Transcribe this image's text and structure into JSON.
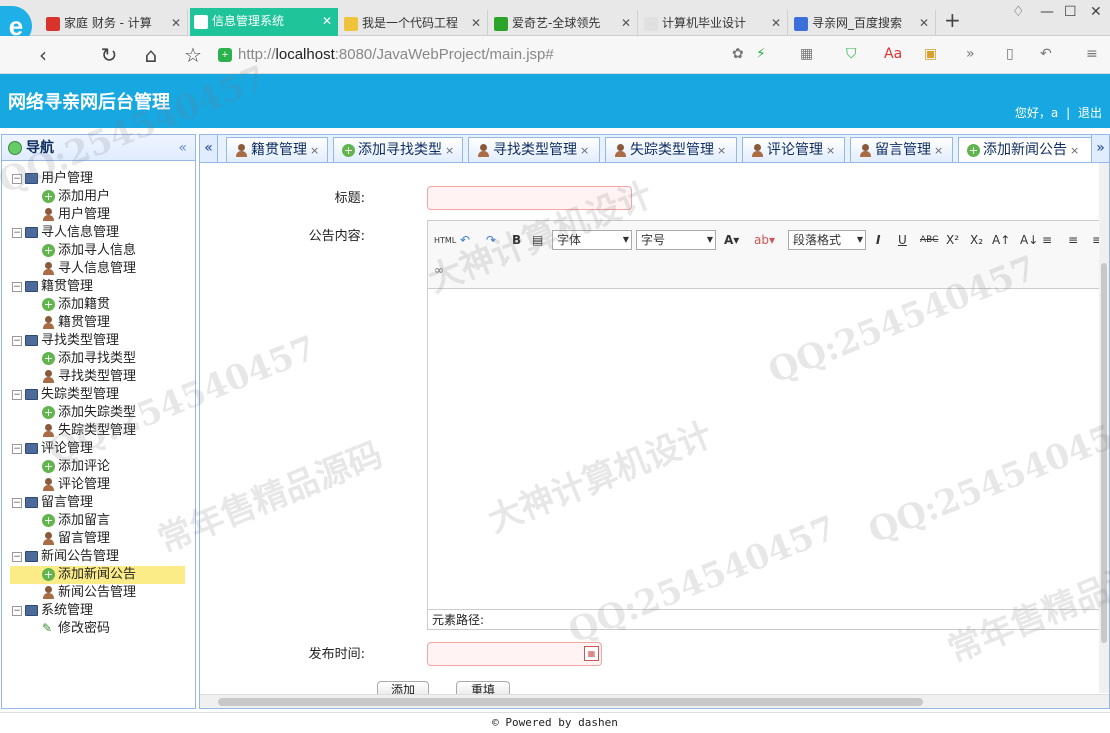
{
  "browser": {
    "tabs": [
      {
        "label": "家庭 财务 - 计算",
        "fav_color": "#d9342b"
      },
      {
        "label": "信息管理系统",
        "fav_color": "#ffffff",
        "active": true
      },
      {
        "label": "我是一个代码工程",
        "fav_color": "#f0c43a"
      },
      {
        "label": "爱奇艺-全球领先",
        "fav_color": "#2aa52a"
      },
      {
        "label": "计算机毕业设计",
        "fav_color": "#e0e0e0"
      },
      {
        "label": "寻亲网_百度搜索",
        "fav_color": "#3b6fd9"
      }
    ],
    "url_prefix": "http://",
    "url_host": "localhost",
    "url_path": ":8080/JavaWebProject/main.jsp#"
  },
  "header": {
    "title": "网络寻亲网后台管理",
    "greeting": "您好，a",
    "logout": "退出"
  },
  "sidebar": {
    "title": "导航",
    "groups": [
      {
        "label": "用户管理",
        "items": [
          "添加用户",
          "用户管理"
        ]
      },
      {
        "label": "寻人信息管理",
        "items": [
          "添加寻人信息",
          "寻人信息管理"
        ]
      },
      {
        "label": "籍贯管理",
        "items": [
          "添加籍贯",
          "籍贯管理"
        ]
      },
      {
        "label": "寻找类型管理",
        "items": [
          "添加寻找类型",
          "寻找类型管理"
        ]
      },
      {
        "label": "失踪类型管理",
        "items": [
          "添加失踪类型",
          "失踪类型管理"
        ]
      },
      {
        "label": "评论管理",
        "items": [
          "添加评论",
          "评论管理"
        ]
      },
      {
        "label": "留言管理",
        "items": [
          "添加留言",
          "留言管理"
        ]
      },
      {
        "label": "新闻公告管理",
        "items": [
          "添加新闻公告",
          "新闻公告管理"
        ]
      },
      {
        "label": "系统管理",
        "items": [
          "修改密码"
        ]
      }
    ],
    "selected": "添加新闻公告"
  },
  "panel_tabs": [
    "籍贯管理",
    "添加寻找类型",
    "寻找类型管理",
    "失踪类型管理",
    "评论管理",
    "留言管理",
    "添加新闻公告"
  ],
  "form": {
    "title_label": "标题:",
    "content_label": "公告内容:",
    "publish_label": "发布时间:",
    "font_family": "字体",
    "font_size": "字号",
    "paragraph": "段落格式",
    "element_path": "元素路径:",
    "add_button": "添加",
    "clear_button": "重填"
  },
  "footer": "© Powered by dashen",
  "watermarks": [
    "QQ:254540457",
    "大神计算机设计",
    "常年售精品源码"
  ]
}
